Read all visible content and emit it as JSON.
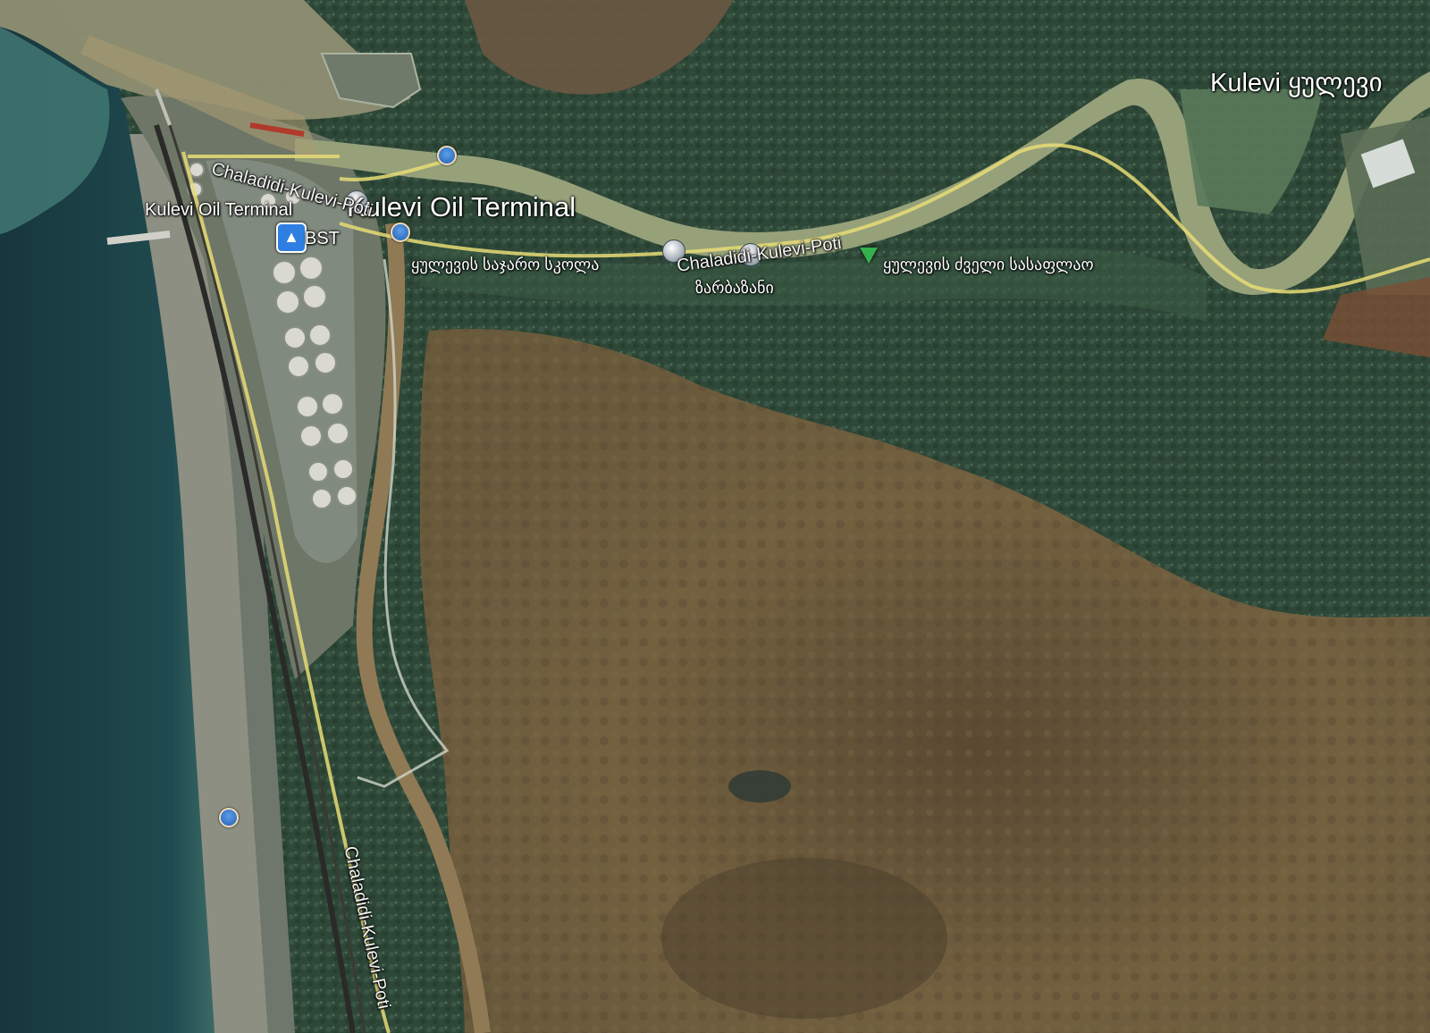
{
  "map": {
    "kind": "satellite",
    "place_labels": {
      "kulevi_village": "Kulevi ყულევი",
      "oil_terminal_large": "Kulevi Oil Terminal",
      "oil_terminal_small": "Kulevi Oil Terminal",
      "bst": "BST"
    },
    "road_labels": {
      "road_top_left": "Chaladidi-Kulevi-Poti",
      "road_middle": "Chaladidi-Kulevi-Poti",
      "road_bottom_vertical": "Chaladidi-Kulevi-Poti"
    },
    "poi_labels": {
      "public_school": "ყულევის საჯარო სკოლა",
      "zarbazani": "ზარბაზანი",
      "old_cemetery": "ყულევის ძველი სასაფლაო"
    },
    "icons": {
      "fuel": "fuel-station-icon",
      "cemetery": "cemetery-pin-icon",
      "school": "school-pin-icon",
      "location": "location-pin-icon"
    },
    "colors": {
      "sea": "#1f4a50",
      "river": "#9aa078",
      "forest": "#2f4a3a",
      "marsh": "#6b5a3c",
      "road": "#e7dc76"
    }
  }
}
